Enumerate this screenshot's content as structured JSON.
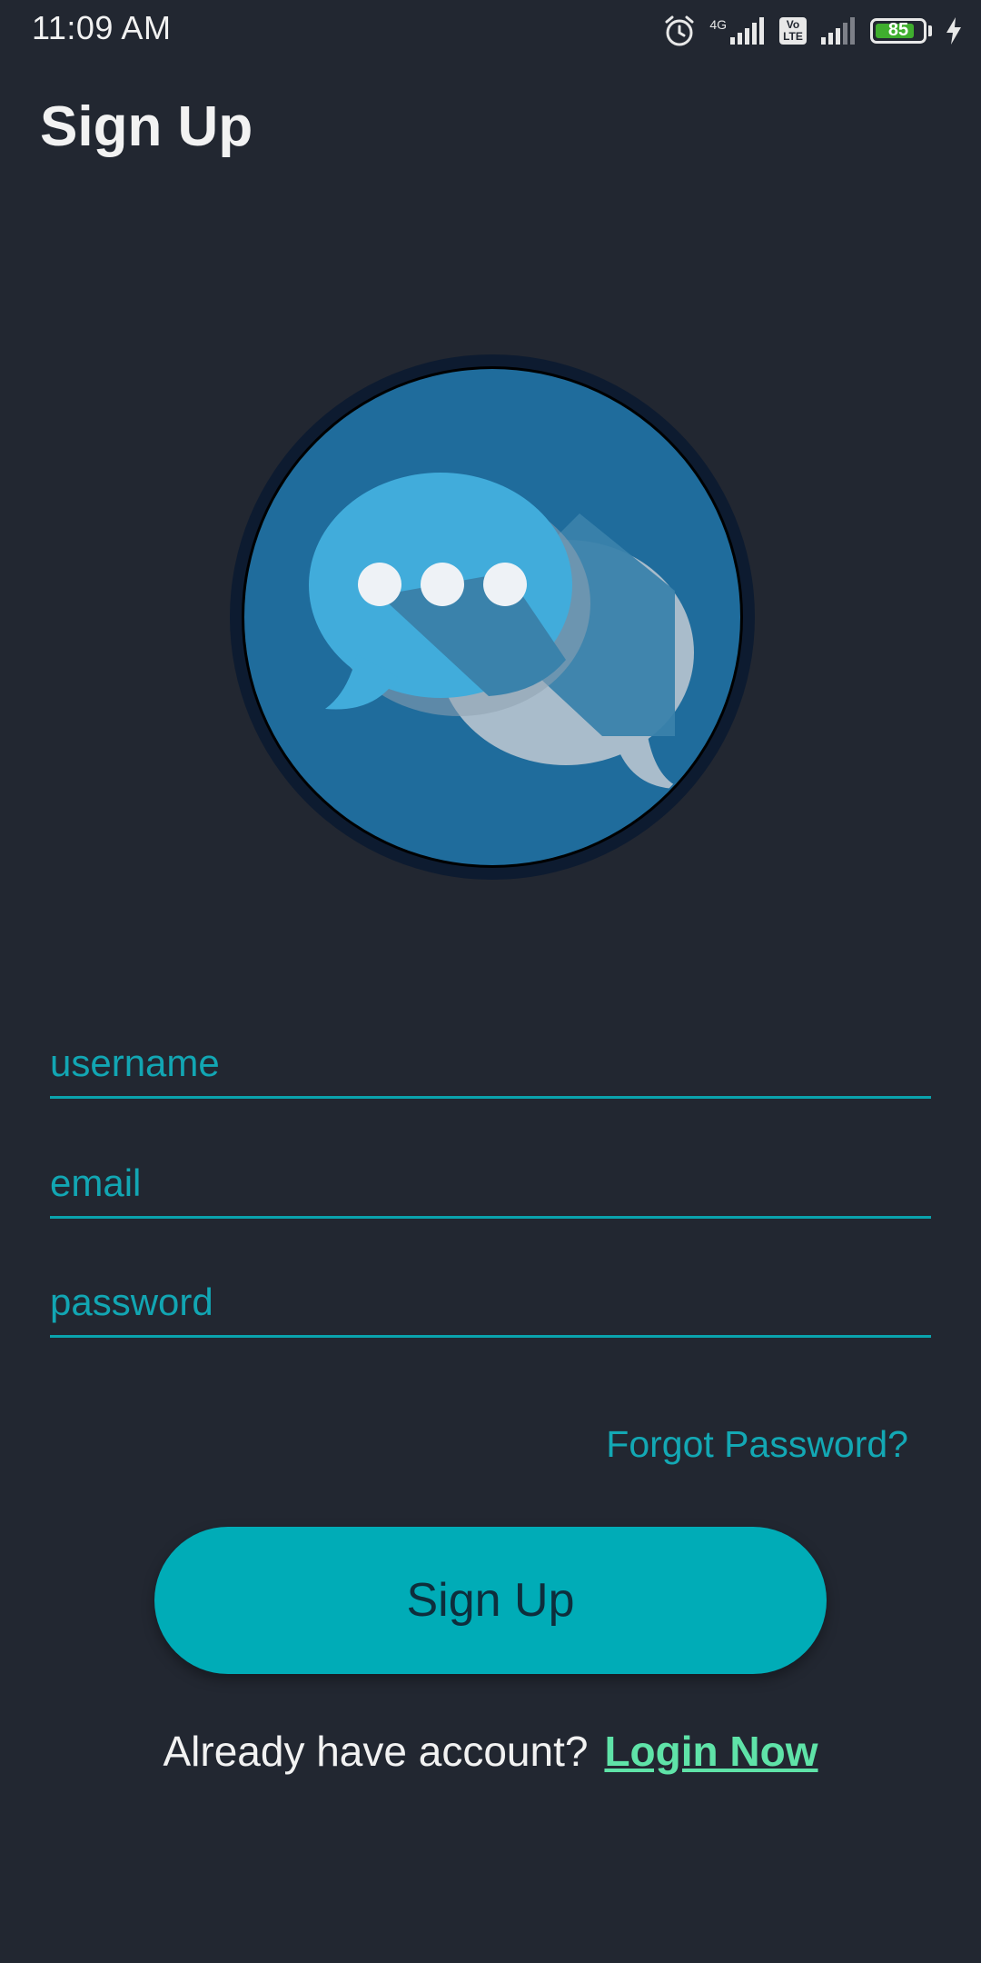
{
  "status_bar": {
    "time": "11:09 AM",
    "network_label": "4G",
    "volte_label": "Vo LTE",
    "battery_percent": "85",
    "icons": [
      "alarm-icon",
      "signal-icon",
      "volte-icon",
      "signal-icon",
      "battery-icon",
      "charging-bolt-icon"
    ]
  },
  "header": {
    "title": "Sign Up"
  },
  "logo": {
    "icon": "chat-bubbles-icon"
  },
  "form": {
    "username_placeholder": "username",
    "email_placeholder": "email",
    "password_placeholder": "password",
    "forgot_password_label": "Forgot Password?",
    "submit_label": "Sign Up"
  },
  "footer": {
    "prompt_text": "Already have account?",
    "login_link_label": "Login Now"
  },
  "colors": {
    "background": "#222731",
    "accent": "#00acb7",
    "link_green": "#5fe3a8"
  }
}
